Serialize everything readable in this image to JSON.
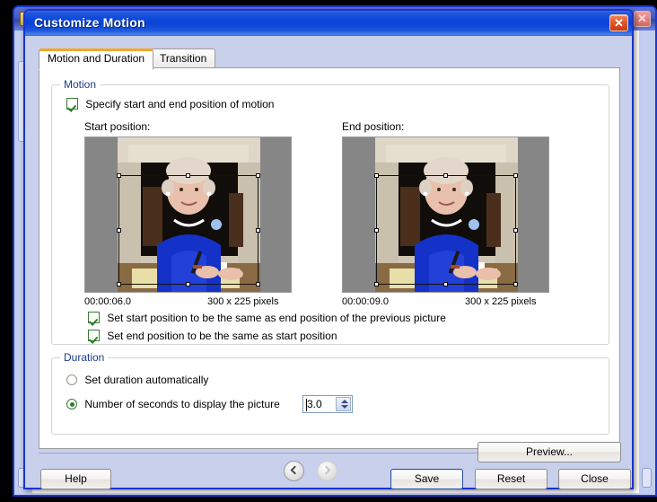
{
  "parent_window": {
    "icon": "app-icon",
    "close_label": "✕"
  },
  "dialog": {
    "title": "Customize Motion",
    "close_label": "✕",
    "tabs": [
      {
        "label": "Motion and Duration",
        "active": true
      },
      {
        "label": "Transition",
        "active": false
      }
    ],
    "motion_group": {
      "title": "Motion",
      "specify_checkbox": {
        "label": "Specify start and end position of motion",
        "checked": true
      },
      "start": {
        "label": "Start position:",
        "time": "00:00:06.0",
        "size": "300 x 225 pixels"
      },
      "end": {
        "label": "End position:",
        "time": "00:00:09.0",
        "size": "300 x 225 pixels"
      },
      "same_as_previous_checkbox": {
        "label": "Set start position to be the same as end position of the previous picture",
        "checked": true
      },
      "same_as_start_checkbox": {
        "label": "Set end position to be the same as start position",
        "checked": true
      }
    },
    "duration_group": {
      "title": "Duration",
      "auto_radio": {
        "label": "Set duration automatically",
        "selected": false
      },
      "seconds_radio": {
        "label": "Number of seconds to display the picture",
        "selected": true
      },
      "seconds_value": "3.0",
      "spinner_up": "▲",
      "spinner_down": "▼"
    },
    "navigation": {
      "prev": "‹",
      "next": "›"
    },
    "buttons": {
      "preview": "Preview...",
      "help": "Help",
      "save": "Save",
      "reset": "Reset",
      "close": "Close"
    }
  },
  "colors": {
    "title_blue": "#0b44d6",
    "dialog_face": "#c8d0ec",
    "tab_accent_orange": "#f2a828",
    "group_label_blue": "#1f3d8c",
    "close_red": "#e2562a",
    "check_green": "#2a7d2a"
  }
}
